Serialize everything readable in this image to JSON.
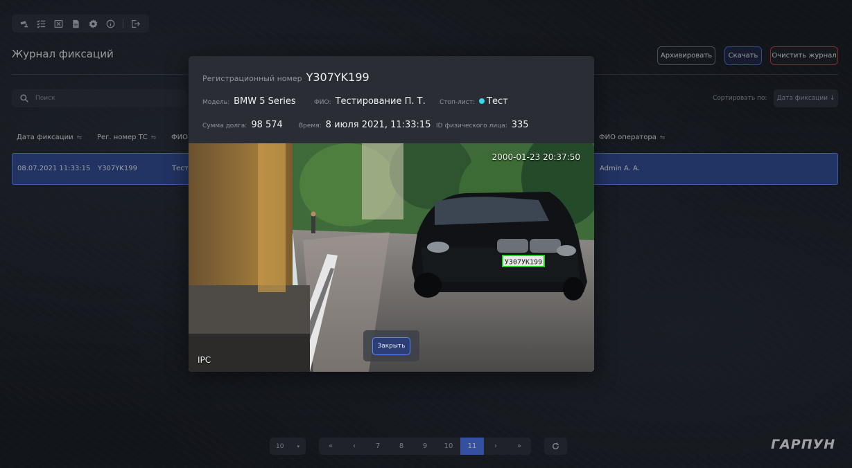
{
  "toolbar": {
    "icons": [
      "camera-icon",
      "checklist-icon",
      "excel-icon",
      "document-icon",
      "gear-icon",
      "info-icon",
      "logout-icon"
    ]
  },
  "page": {
    "title": "Журнал фиксаций"
  },
  "actions": {
    "archive": "Архивировать",
    "download": "Скачать",
    "clear": "Очистить журнал"
  },
  "search": {
    "placeholder": "Поиск"
  },
  "sort": {
    "label": "Сортировать по:",
    "value": "Дата фиксации ↓"
  },
  "table": {
    "headers": [
      "Дата фиксации",
      "Рег. номер ТС",
      "ФИО",
      "ФИО оператора"
    ],
    "row": {
      "date": "08.07.2021 11:33:15",
      "plate": "Y307YK199",
      "fio": "Тестирование П. Т.",
      "operator": "Admin A. A."
    }
  },
  "modal": {
    "reg_label": "Регистрационный номер",
    "reg_value": "Y307YK199",
    "model_label": "Модель:",
    "model_value": "BMW 5 Series",
    "fio_label": "ФИО:",
    "fio_value": "Тестирование П. Т.",
    "stoplist_label": "Стоп-лист:",
    "stoplist_value": "Тест",
    "debt_label": "Сумма долга:",
    "debt_value": "98 574",
    "time_label": "Время:",
    "time_value": "8 июля 2021, 11:33:15",
    "person_label": "ID физического лица:",
    "person_value": "335",
    "photo_timestamp": "2000-01-23 20:37:50",
    "photo_source": "IPC",
    "photo_plate": "У307УК199",
    "close": "Закрыть"
  },
  "pagination": {
    "page_size": "10",
    "pages": [
      "«",
      "‹",
      "7",
      "8",
      "9",
      "10",
      "11",
      "›",
      "»"
    ],
    "active": "11"
  },
  "brand": {
    "logo": "ГАРПУН"
  },
  "colors": {
    "accent": "#4d77f0",
    "danger": "#d23a3a",
    "stoplist_dot": "#35d6ee"
  }
}
